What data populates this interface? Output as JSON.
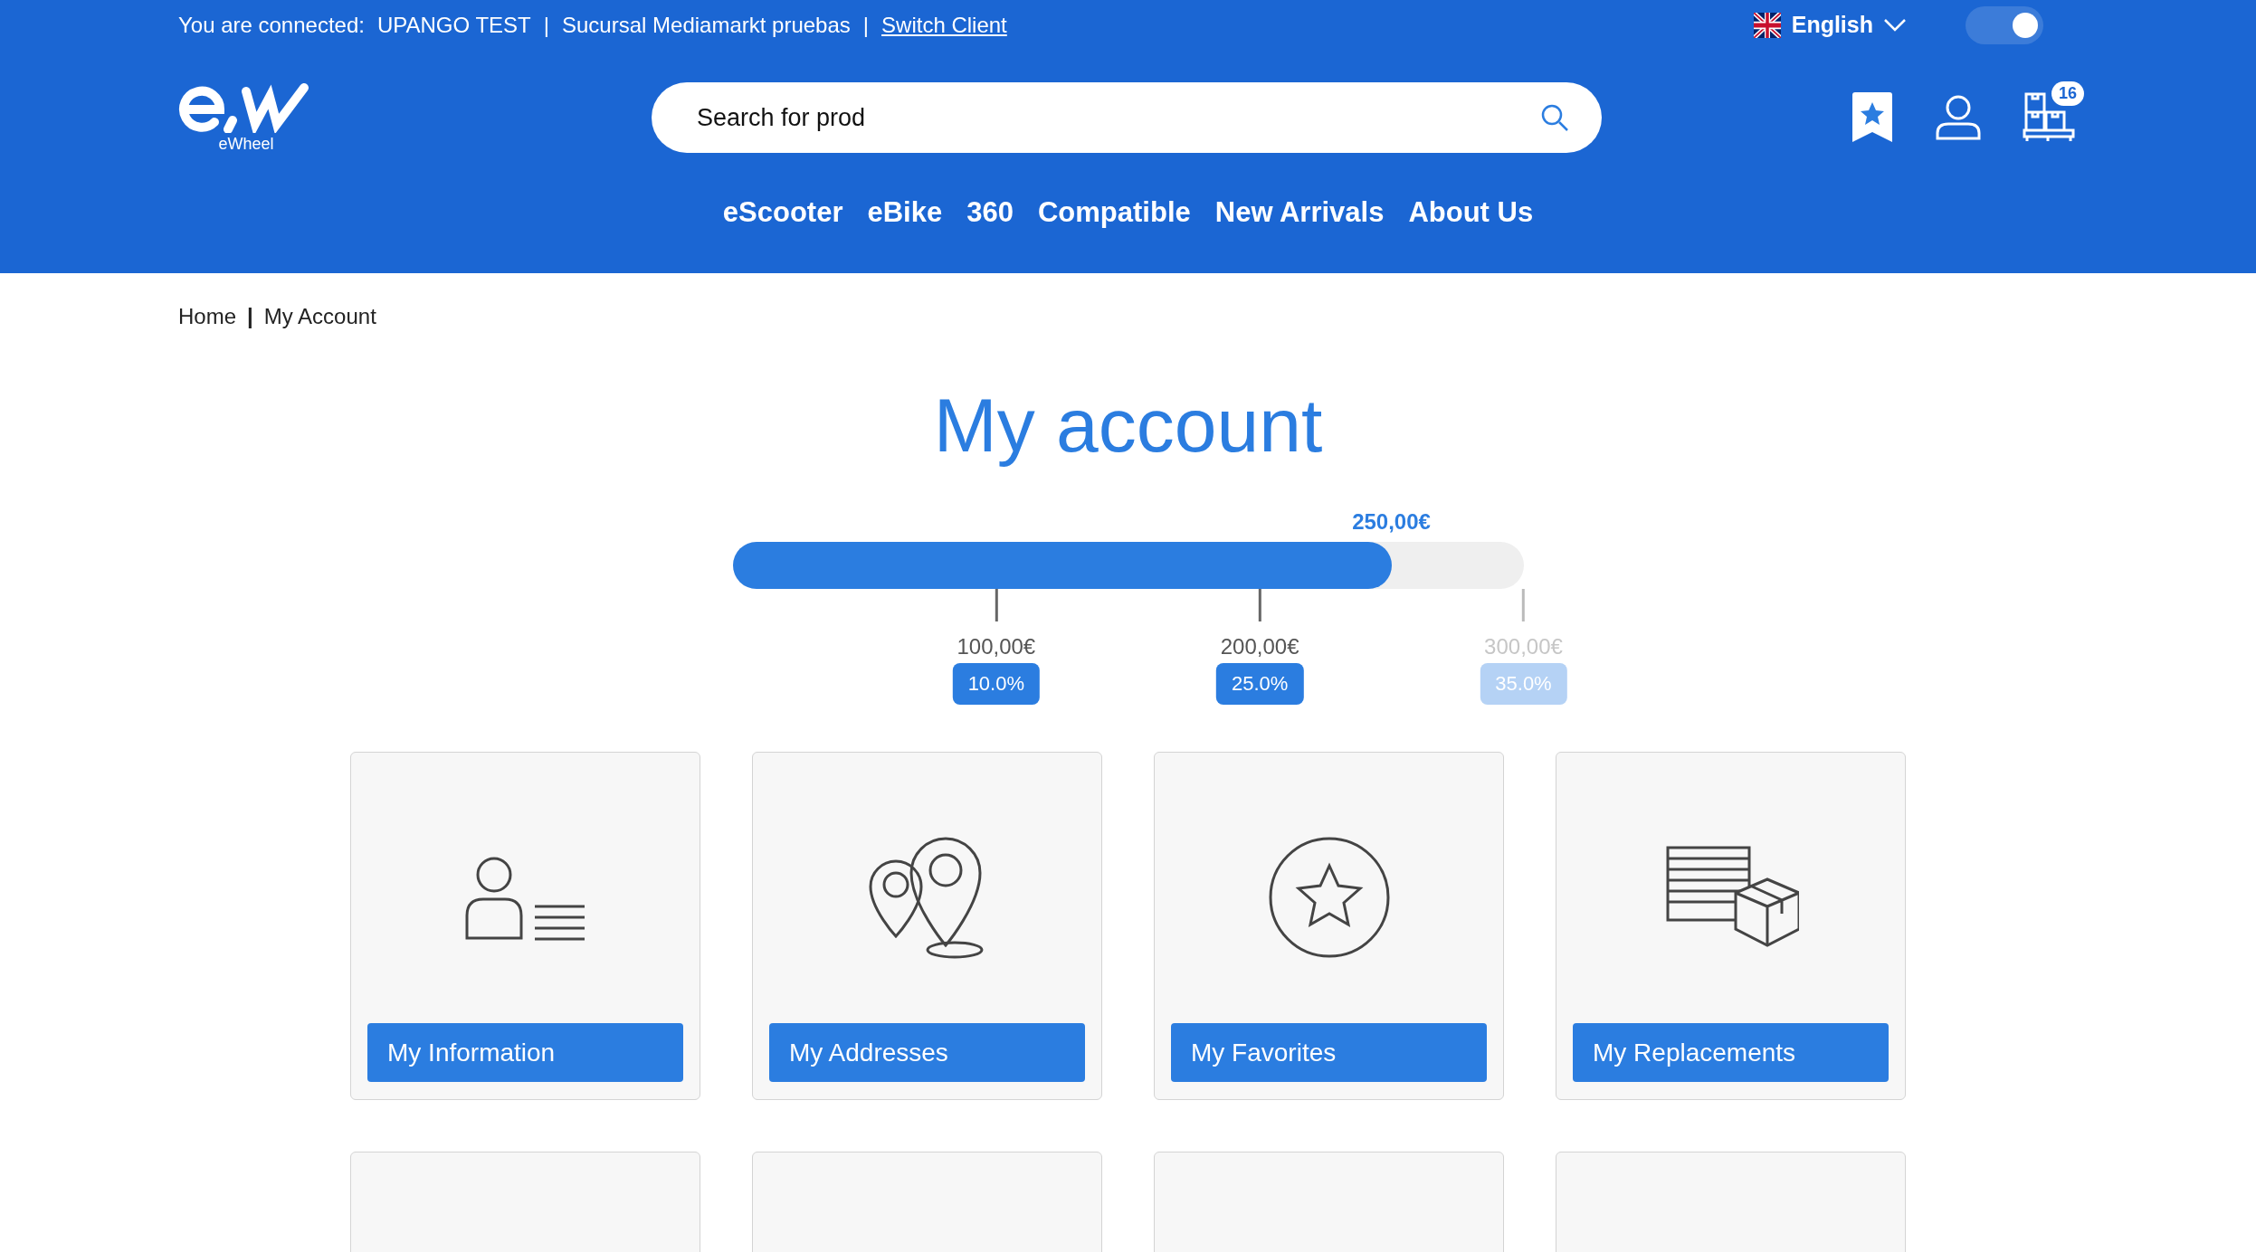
{
  "top_bar": {
    "connection": [
      "You are connected:",
      "UPANGO TEST",
      "|",
      "Sucursal Mediamarkt pruebas",
      "|"
    ],
    "switch_link": "Switch Client",
    "language": "English",
    "toggle_on": true
  },
  "header": {
    "logo_caption": "eWheel",
    "search": {
      "value": "Search for prod"
    },
    "cart_count": "16"
  },
  "nav": [
    "eScooter",
    "eBike",
    "360",
    "Compatible",
    "New Arrivals",
    "About Us"
  ],
  "breadcrumb": {
    "items": [
      "Home",
      "My Account"
    ],
    "separator": "|"
  },
  "title": "My account",
  "progress": {
    "current": "250,00€",
    "level": 0.833,
    "tiers": [
      {
        "amount": "100,00€",
        "discount": "10.0%",
        "reached": true
      },
      {
        "amount": "200,00€",
        "discount": "25.0%",
        "reached": true
      },
      {
        "amount": "300,00€",
        "discount": "35.0%",
        "reached": false
      }
    ]
  },
  "cards": [
    {
      "kind": "information",
      "label": "My Information"
    },
    {
      "kind": "addresses",
      "label": "My Addresses"
    },
    {
      "kind": "favorites",
      "label": "My Favorites"
    },
    {
      "kind": "replacements",
      "label": "My Replacements"
    },
    {
      "kind": "partial"
    },
    {
      "kind": "partial"
    },
    {
      "kind": "partial"
    },
    {
      "kind": "partial"
    }
  ]
}
